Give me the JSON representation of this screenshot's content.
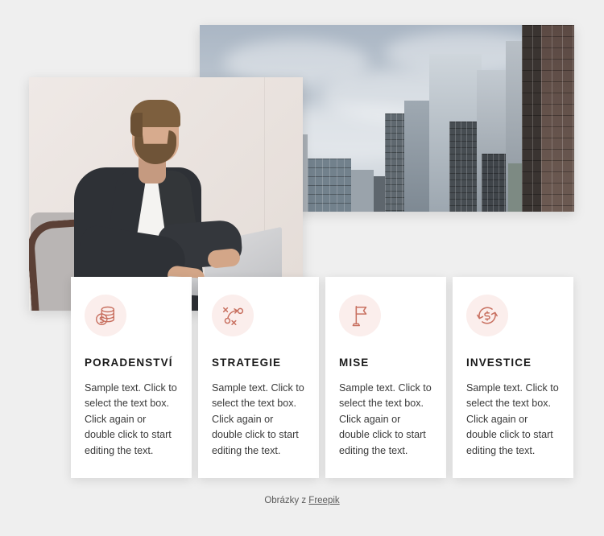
{
  "page": {
    "background_color": "#efefef",
    "accent_color": "#c87060",
    "icon_circle_color": "#fbeeec"
  },
  "images": [
    {
      "name": "cityscape-photo",
      "alt": "Modern glass and concrete skyscrapers viewed from street level against an overcast grey-blue sky"
    },
    {
      "name": "businessman-photo",
      "alt": "Bearded businessman in a dark blazer and white t-shirt typing on a laptop while seated in a grey armchair"
    }
  ],
  "cards": [
    {
      "icon": "coins-stack-icon",
      "title": "PORADENSTVÍ",
      "text": "Sample text. Click to select the text box. Click again or double click to start editing the text."
    },
    {
      "icon": "strategy-playbook-icon",
      "title": "STRATEGIE",
      "text": "Sample text. Click to select the text box. Click again or double click to start editing the text."
    },
    {
      "icon": "flag-icon",
      "title": "MISE",
      "text": "Sample text. Click to select the text box. Click again or double click to start editing the text."
    },
    {
      "icon": "money-refresh-icon",
      "title": "INVESTICE",
      "text": "Sample text. Click to select the text box. Click again or double click to start editing the text."
    }
  ],
  "footer": {
    "prefix": "Obrázky z ",
    "link_label": "Freepik"
  }
}
